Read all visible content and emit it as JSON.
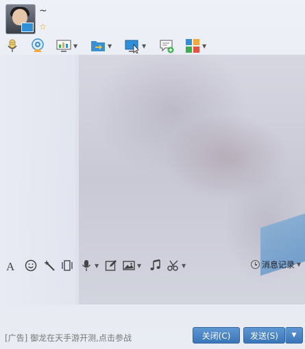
{
  "header": {
    "nickname": "~",
    "star_icon": "star-icon"
  },
  "toolbar": {
    "items": [
      {
        "icon": "microphone-icon",
        "has_dropdown": false
      },
      {
        "icon": "webcam-icon",
        "has_dropdown": false
      },
      {
        "icon": "screen-share-icon",
        "has_dropdown": true
      },
      {
        "icon": "file-transfer-icon",
        "has_dropdown": true
      },
      {
        "icon": "remote-desktop-icon",
        "has_dropdown": true
      },
      {
        "icon": "new-message-icon",
        "has_dropdown": false
      },
      {
        "icon": "apps-icon",
        "has_dropdown": true
      }
    ]
  },
  "editbar": {
    "items": [
      {
        "icon": "font-icon"
      },
      {
        "icon": "emoji-icon"
      },
      {
        "icon": "magic-wand-icon"
      },
      {
        "icon": "shake-window-icon"
      },
      {
        "icon": "voice-message-icon"
      },
      {
        "icon": "edit-icon"
      },
      {
        "icon": "image-icon"
      },
      {
        "icon": "music-icon"
      },
      {
        "icon": "screenshot-scissors-icon"
      }
    ],
    "history_label": "消息记录"
  },
  "footer": {
    "ad_text": "[广告] 御龙在天手游开测,点击参战",
    "close_label": "关闭(C)",
    "send_label": "发送(S)"
  },
  "colors": {
    "button_blue": "#3a75b8",
    "star": "#e8a31a"
  }
}
